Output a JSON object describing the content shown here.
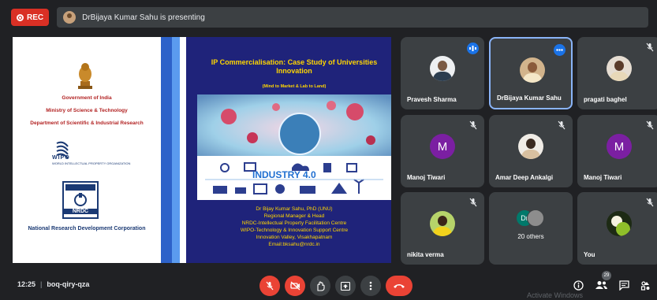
{
  "topbar": {
    "rec_label": "REC",
    "presenting_text": "DrBijaya Kumar Sahu is presenting"
  },
  "slide": {
    "left": {
      "gov_line1": "Government of India",
      "gov_line2": "Ministry of Science & Technology",
      "gov_line3": "Department of Scientific & Industrial Research",
      "wipo_label": "WIPO",
      "wipo_sub": "WORLD INTELLECTUAL PROPERTY ORGANIZATION",
      "nrdc_label": "NRDC",
      "org_name": "National Research Development Corporation"
    },
    "right": {
      "title": "IP Commercialisation: Case Study of Universities Innovation",
      "subtitle": "(Mind to Market & Lab to Land)",
      "industry_label": "INDUSTRY 4.0",
      "speaker_lines": [
        "Dr Bijay Kumar Sahu, PhD (UNU)",
        "Regional Manager & Head",
        "NRDC-Intellectual Property Facilitation Centre",
        "WIPO-Technology & Innovation Support Centre",
        "Innovation Valley, Visakhapatnam",
        "Email:bksahu@nrdc.in"
      ]
    }
  },
  "participants": [
    {
      "name": "Pravesh Sharma",
      "type": "photo",
      "status": "speaking"
    },
    {
      "name": "DrBijaya Kumar Sahu",
      "type": "photo",
      "status": "more",
      "active": true
    },
    {
      "name": "pragati baghel",
      "type": "photo",
      "status": "muted"
    },
    {
      "name": "Manoj Tiwari",
      "type": "letter",
      "initial": "M",
      "status": "muted"
    },
    {
      "name": "Amar Deep Ankalgi",
      "type": "photo",
      "status": "muted"
    },
    {
      "name": "Manoj Tiwari",
      "type": "letter",
      "initial": "M",
      "status": "muted"
    },
    {
      "name": "nikita verma",
      "type": "photo",
      "status": "muted"
    },
    {
      "name": "20 others",
      "type": "others",
      "initial": "Dr"
    },
    {
      "name": "You",
      "type": "photo",
      "status": "muted"
    }
  ],
  "bottombar": {
    "time": "12:25",
    "separator": "|",
    "meeting_code": "boq-qiry-qza",
    "people_count": "29",
    "watermark": "Activate Windows"
  },
  "colors": {
    "background": "#202124",
    "tile": "#3c4043",
    "danger": "#ea4335",
    "accent": "#8ab4f8",
    "slide_navy": "#1f237a",
    "slide_yellow": "#ffd600"
  }
}
